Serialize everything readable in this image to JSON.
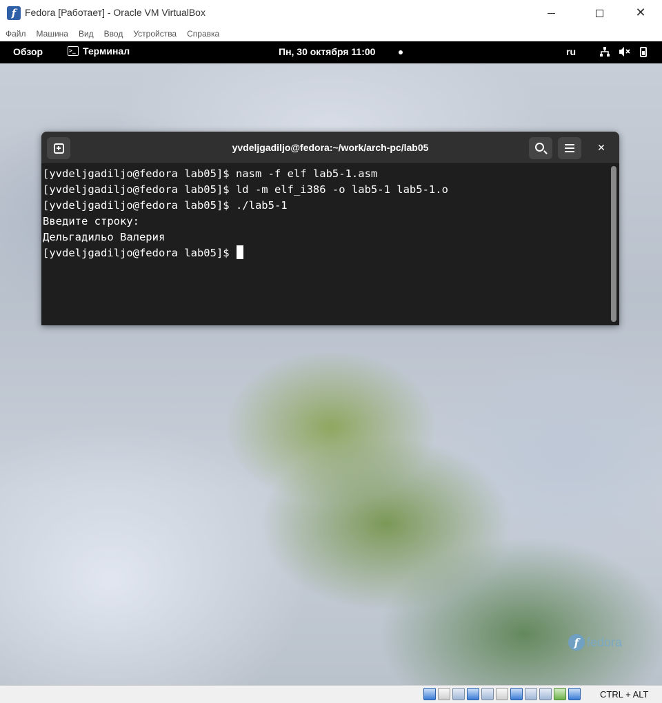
{
  "host_window": {
    "title": "Fedora [Работает] - Oracle VM VirtualBox",
    "icon": "virtualbox-icon",
    "controls": [
      "minimize",
      "maximize",
      "close"
    ]
  },
  "menubar": {
    "items": [
      "Файл",
      "Машина",
      "Вид",
      "Ввод",
      "Устройства",
      "Справка"
    ]
  },
  "gnome": {
    "overview_label": "Обзор",
    "app_name": "Терминал",
    "clock": "Пн, 30 октября  11:00",
    "language": "ru",
    "tray_icons": [
      "network-icon",
      "volume-muted-icon",
      "battery-icon"
    ]
  },
  "terminal": {
    "title": "yvdeljgadiljo@fedora:~/work/arch-pc/lab05",
    "lines": [
      "[yvdeljgadiljo@fedora lab05]$ nasm -f elf lab5-1.asm",
      "[yvdeljgadiljo@fedora lab05]$ ld -m elf_i386 -o lab5-1 lab5-1.o",
      "[yvdeljgadiljo@fedora lab05]$ ./lab5-1",
      "Введите строку:",
      "Дельгадильо Валерия",
      "[yvdeljgadiljo@fedora lab05]$ "
    ]
  },
  "wallpaper": {
    "logo_text": "fedora"
  },
  "statusbar": {
    "host_key": "CTRL + ALT"
  },
  "colors": {
    "gnome_bar": "#000000",
    "terminal_bg": "#1e1e1e",
    "terminal_header": "#303030"
  }
}
